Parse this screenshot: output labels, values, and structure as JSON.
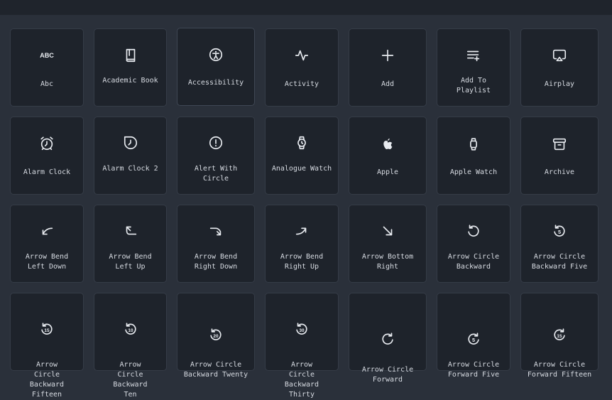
{
  "icons": [
    {
      "label": "Abc",
      "icon": "abc-icon"
    },
    {
      "label": "Academic Book",
      "icon": "academic-book-icon"
    },
    {
      "label": "Accessibility",
      "icon": "accessibility-icon"
    },
    {
      "label": "Activity",
      "icon": "activity-icon"
    },
    {
      "label": "Add",
      "icon": "add-icon"
    },
    {
      "label": "Add To Playlist",
      "icon": "add-to-playlist-icon"
    },
    {
      "label": "Airplay",
      "icon": "airplay-icon"
    },
    {
      "label": "Alarm Clock",
      "icon": "alarm-clock-icon"
    },
    {
      "label": "Alarm Clock 2",
      "icon": "alarm-clock-2-icon"
    },
    {
      "label": "Alert With Circle",
      "icon": "alert-with-circle-icon"
    },
    {
      "label": "Analogue Watch",
      "icon": "analogue-watch-icon"
    },
    {
      "label": "Apple",
      "icon": "apple-icon"
    },
    {
      "label": "Apple Watch",
      "icon": "apple-watch-icon"
    },
    {
      "label": "Archive",
      "icon": "archive-icon"
    },
    {
      "label": "Arrow Bend Left Down",
      "icon": "arrow-bend-left-down-icon"
    },
    {
      "label": "Arrow Bend Left Up",
      "icon": "arrow-bend-left-up-icon"
    },
    {
      "label": "Arrow Bend Right Down",
      "icon": "arrow-bend-right-down-icon"
    },
    {
      "label": "Arrow Bend Right Up",
      "icon": "arrow-bend-right-up-icon"
    },
    {
      "label": "Arrow Bottom Right",
      "icon": "arrow-bottom-right-icon"
    },
    {
      "label": "Arrow Circle Backward",
      "icon": "arrow-circle-backward-icon"
    },
    {
      "label": "Arrow Circle Backward Five",
      "icon": "arrow-circle-backward-five-icon"
    },
    {
      "label": "Arrow Circle Backward Fifteen",
      "icon": "arrow-circle-backward-fifteen-icon",
      "badge": "15"
    },
    {
      "label": "Arrow Circle Backward Ten",
      "icon": "arrow-circle-backward-ten-icon",
      "badge": "10"
    },
    {
      "label": "Arrow Circle Backward Twenty",
      "icon": "arrow-circle-backward-twenty-icon",
      "badge": "20"
    },
    {
      "label": "Arrow Circle Backward Thirty",
      "icon": "arrow-circle-backward-thirty-icon",
      "badge": "30"
    },
    {
      "label": "Arrow Circle Forward",
      "icon": "arrow-circle-forward-icon"
    },
    {
      "label": "Arrow Circle Forward Five",
      "icon": "arrow-circle-forward-five-icon",
      "badge": "5"
    },
    {
      "label": "Arrow Circle Forward Fifteen",
      "icon": "arrow-circle-forward-fifteen-icon",
      "badge": "15"
    }
  ],
  "abc_glyph": "ABC",
  "backward_five_badge": "5"
}
